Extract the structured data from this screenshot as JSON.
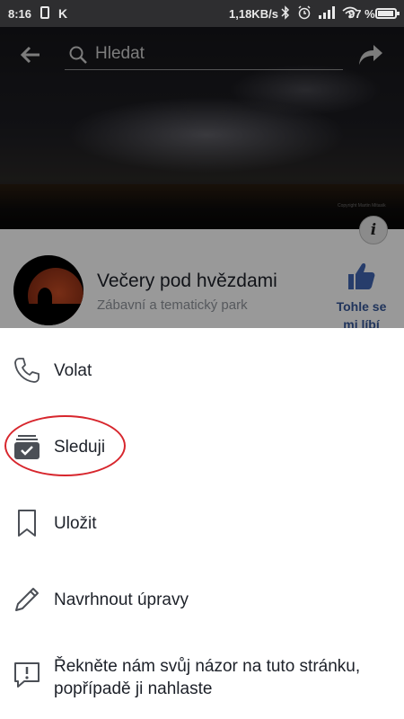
{
  "status_bar": {
    "time": "8:16",
    "speed": "1,18KB/s",
    "battery_percent_text": "97 %",
    "battery_level": 0.97,
    "icons": [
      "notification-box-icon",
      "k-app-icon",
      "bluetooth-icon",
      "alarm-icon",
      "signal-icon",
      "wifi-icon",
      "battery-icon"
    ]
  },
  "top_bar": {
    "search_placeholder": "Hledat",
    "icons": [
      "back-arrow-icon",
      "search-icon",
      "share-icon"
    ]
  },
  "cover": {
    "copyright_text": "Copyright Martin Mitasik",
    "info_glyph": "i"
  },
  "page": {
    "title": "Večery pod hvězdami",
    "category": "Zábavní a tematický park",
    "like_label": "Tohle se mi líbí",
    "like_color": "#365899"
  },
  "sheet": {
    "items": [
      {
        "label": "Volat",
        "icon": "phone-icon"
      },
      {
        "label": "Sleduji",
        "icon": "following-check-icon"
      },
      {
        "label": "Uložit",
        "icon": "bookmark-icon"
      },
      {
        "label": "Navrhnout úpravy",
        "icon": "pencil-icon"
      },
      {
        "label": "Řekněte nám svůj názor na tuto stránku, popřípadě ji nahlaste",
        "icon": "report-flag-icon"
      }
    ],
    "highlight_color": "#d7262d"
  }
}
